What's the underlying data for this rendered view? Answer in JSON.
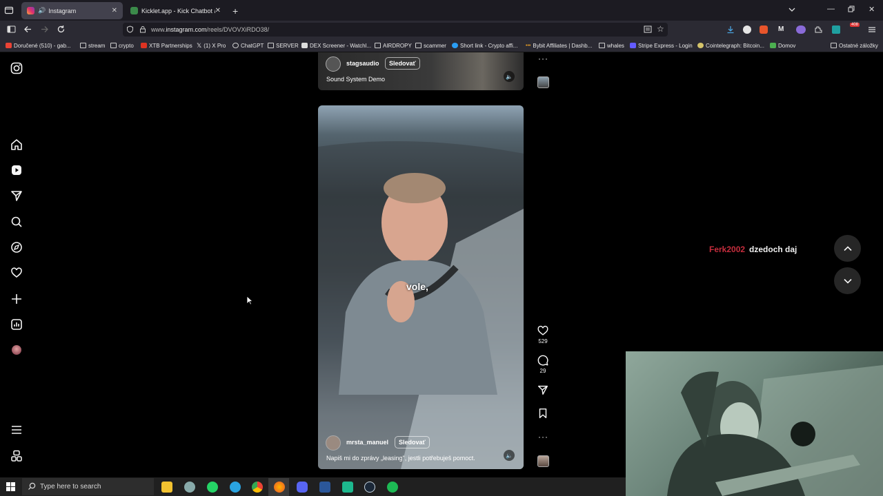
{
  "browser": {
    "tabs": [
      {
        "label": "Instagram",
        "active": true
      },
      {
        "label": "Kicklet.app - Kick Chatbot and",
        "active": false
      }
    ],
    "url_prefix": "www.",
    "url_domain": "instagram.com",
    "url_path": "/reels/DVOVXiRDO38/",
    "extension_badge": "408",
    "bookmarks": [
      "Doručené (510) - gab...",
      "stream",
      "crypto",
      "XTB Partnerships",
      "(1) X Pro",
      "ChatGPT",
      "SERVER",
      "DEX Screener - Watchl...",
      "AIRDROPY",
      "scammer",
      "Short link - Crypto affi...",
      "Bybit Affiliates | Dashb...",
      "whales",
      "Stripe Express - Login",
      "Cointelegraph: Bitcoin...",
      "Domov"
    ],
    "bookmarks_other": "Ostatné záložky"
  },
  "reels": [
    {
      "username": "stagsaudio",
      "follow_label": "Sledovať",
      "caption": "Sound System Demo"
    },
    {
      "username": "mrsta_manuel",
      "follow_label": "Sledovať",
      "caption": "Napiš mi do zprávy „leasing\", jestli potřebuješ pomoct.",
      "subtitle": "vole,",
      "likes": "529",
      "comments": "29"
    }
  ],
  "chat": {
    "user": "Ferk2002",
    "message": "dzedoch daj"
  },
  "taskbar": {
    "search_placeholder": "Type here to search"
  },
  "colors": {
    "chat_user": "#c62d3d",
    "page_bg": "#000000",
    "tab_active": "#42414d"
  },
  "icons": [
    "instagram-icon",
    "home-icon",
    "reels-icon",
    "messages-icon",
    "search-icon",
    "explore-icon",
    "notifications-icon",
    "create-icon",
    "dashboard-icon",
    "menu-icon",
    "threads-icon",
    "heart-icon",
    "comment-icon",
    "share-icon",
    "bookmark-icon",
    "more-icon",
    "chevron-up-icon",
    "chevron-down-icon"
  ]
}
